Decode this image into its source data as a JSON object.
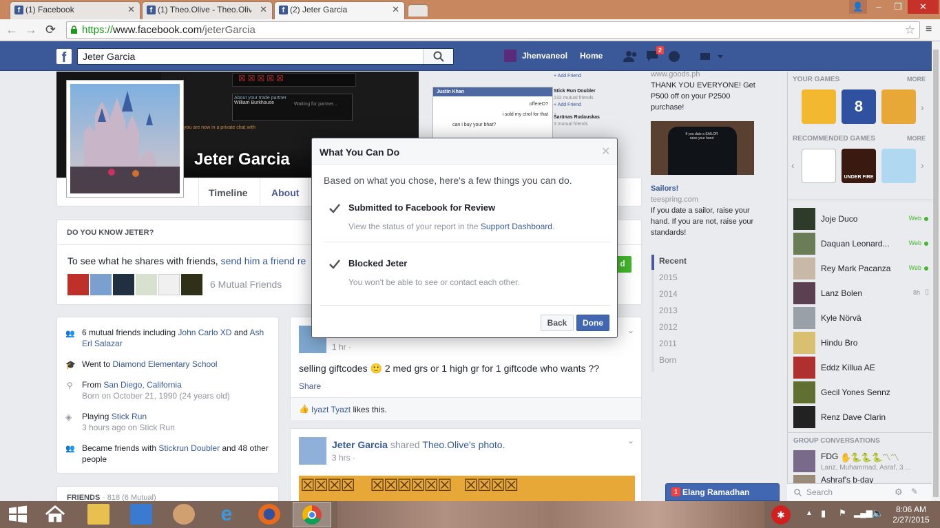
{
  "browser": {
    "tabs": [
      {
        "title": "(1) Facebook",
        "active": false
      },
      {
        "title": "(1) Theo.Olive - Theo.Olive",
        "active": false
      },
      {
        "title": "(2) Jeter Garcia",
        "active": true
      }
    ],
    "url_scheme": "https://",
    "url_host": "www.facebook.com",
    "url_path": "/jeterGarcia"
  },
  "fb_header": {
    "logo": "f",
    "search_value": "Jeter Garcia",
    "user_name": "Jhenvaneol",
    "home_label": "Home",
    "messages_badge": "2"
  },
  "profile": {
    "name": "Jeter Garcia",
    "tabs": [
      "Timeline",
      "About"
    ],
    "cover_snippets": {
      "private_chat": "you are now in a private chat with",
      "trade_partner": "About your trade partner",
      "partner_name": "William Burkhouse",
      "waiting": "Waiting for partner...",
      "chat_header": "Justin Khan",
      "chat_lines": [
        "offereO?",
        "i sold my ctrol for that",
        "can i buy your bhat?"
      ],
      "suggestions": [
        "+ Add Friend",
        "Stick Run Doubler",
        "132 mutual friends",
        "+ Add Friend",
        "Šarūnas Rudauskas",
        "3 mutual friends"
      ]
    }
  },
  "know": {
    "heading": "DO YOU KNOW JETER?",
    "text_prefix": "To see what he shares with friends,",
    "link": "send him a friend re",
    "mutual_label": "6 Mutual Friends",
    "add_btn": "d"
  },
  "intro": [
    {
      "icon": "people-icon",
      "text": "6 mutual friends including",
      "link1": "John Carlo XD",
      "mid": "and",
      "link2": "Ash Erl Salazar"
    },
    {
      "icon": "school-icon",
      "text": "Went to",
      "link1": "Diamond Elementary School"
    },
    {
      "icon": "location-icon",
      "text": "From",
      "link1": "San Diego, California",
      "sub": "Born on October 21, 1990 (24 years old)"
    },
    {
      "icon": "game-icon",
      "text": "Playing",
      "link1": "Stick Run",
      "sub": "3 hours ago on Stick Run"
    },
    {
      "icon": "people-icon",
      "text": "Became friends with",
      "link1": "Stickrun Doubler",
      "mid": "and 48 other people"
    }
  ],
  "friends_heading": "FRIENDS",
  "friends_count": "· 818 (6 Mutual)",
  "post1": {
    "time": "1 hr ·",
    "text": "selling giftcodes 🙂 2 med grs or 1 high gr for 1 giftcode who wants ??",
    "share": "Share",
    "liker": "Iyazt Tyazt",
    "likes_suffix": "likes this."
  },
  "post2": {
    "author": "Jeter Garcia",
    "shared": "shared",
    "owner": "Theo.Olive's",
    "object": "photo.",
    "time": "3 hrs ·"
  },
  "ads": {
    "ad1_url": "www.goods.ph",
    "ad1_text": "THANK YOU EVERYONE! Get P500 off on your P2500 purchase!",
    "ad2_title": "Sailors!",
    "ad2_url": "teespring.com",
    "ad2_text": "If you date a sailor, raise your hand. If you are not, raise your standards!",
    "shirt_text": "If you date a SAILOR raise your hand"
  },
  "years": [
    "Recent",
    "2015",
    "2014",
    "2013",
    "2012",
    "2011",
    "Born"
  ],
  "right_col": {
    "games_heading": "YOUR GAMES",
    "more": "MORE",
    "rec_heading": "RECOMMENDED GAMES",
    "rec_more": "MORE",
    "under_fire": "UNDER FIRE",
    "contacts": [
      {
        "name": "Joje Duco",
        "status": "Web",
        "avatar": "#2e3b2a"
      },
      {
        "name": "Daquan Leonard...",
        "status": "Web",
        "avatar": "#6b7d57"
      },
      {
        "name": "Rey Mark Pacanza",
        "status": "Web",
        "avatar": "#c8b8a8"
      },
      {
        "name": "Lanz Bolen",
        "status": "8h",
        "avatar": "#5a4050"
      },
      {
        "name": "Kyle Nörvä",
        "status": "",
        "avatar": "#9aa0a8"
      },
      {
        "name": "Hindu Bro",
        "status": "",
        "avatar": "#d8c070"
      },
      {
        "name": "Eddz Killua AE",
        "status": "",
        "avatar": "#b03030"
      },
      {
        "name": "Gecil Yones Sennz",
        "status": "",
        "avatar": "#607030"
      },
      {
        "name": "Renz Dave Clarin",
        "status": "",
        "avatar": "#222222"
      }
    ],
    "group_heading": "GROUP CONVERSATIONS",
    "group1_name": "FDG",
    "group1_members": "Lanz, Muhammad, Asraf, 3 ...",
    "group2_name": "Ashraf's b-day",
    "search_placeholder": "Search"
  },
  "chat_tab": {
    "badge": "1",
    "name": "Elang Ramadhan"
  },
  "dialog": {
    "title": "What You Can Do",
    "intro": "Based on what you chose, here's a few things you can do.",
    "item1_title": "Submitted to Facebook for Review",
    "item1_desc": "View the status of your report in the",
    "item1_link": "Support Dashboard",
    "item1_end": ".",
    "item2_title": "Blocked Jeter",
    "item2_desc": "You won't be able to see or contact each other.",
    "back": "Back",
    "done": "Done"
  },
  "taskbar": {
    "time": "8:06 AM",
    "date": "2/27/2015"
  },
  "colors": {
    "fb_blue": "#3b5998",
    "link": "#365899",
    "online_green": "#42b72a",
    "badge_red": "#fa3e3e"
  }
}
